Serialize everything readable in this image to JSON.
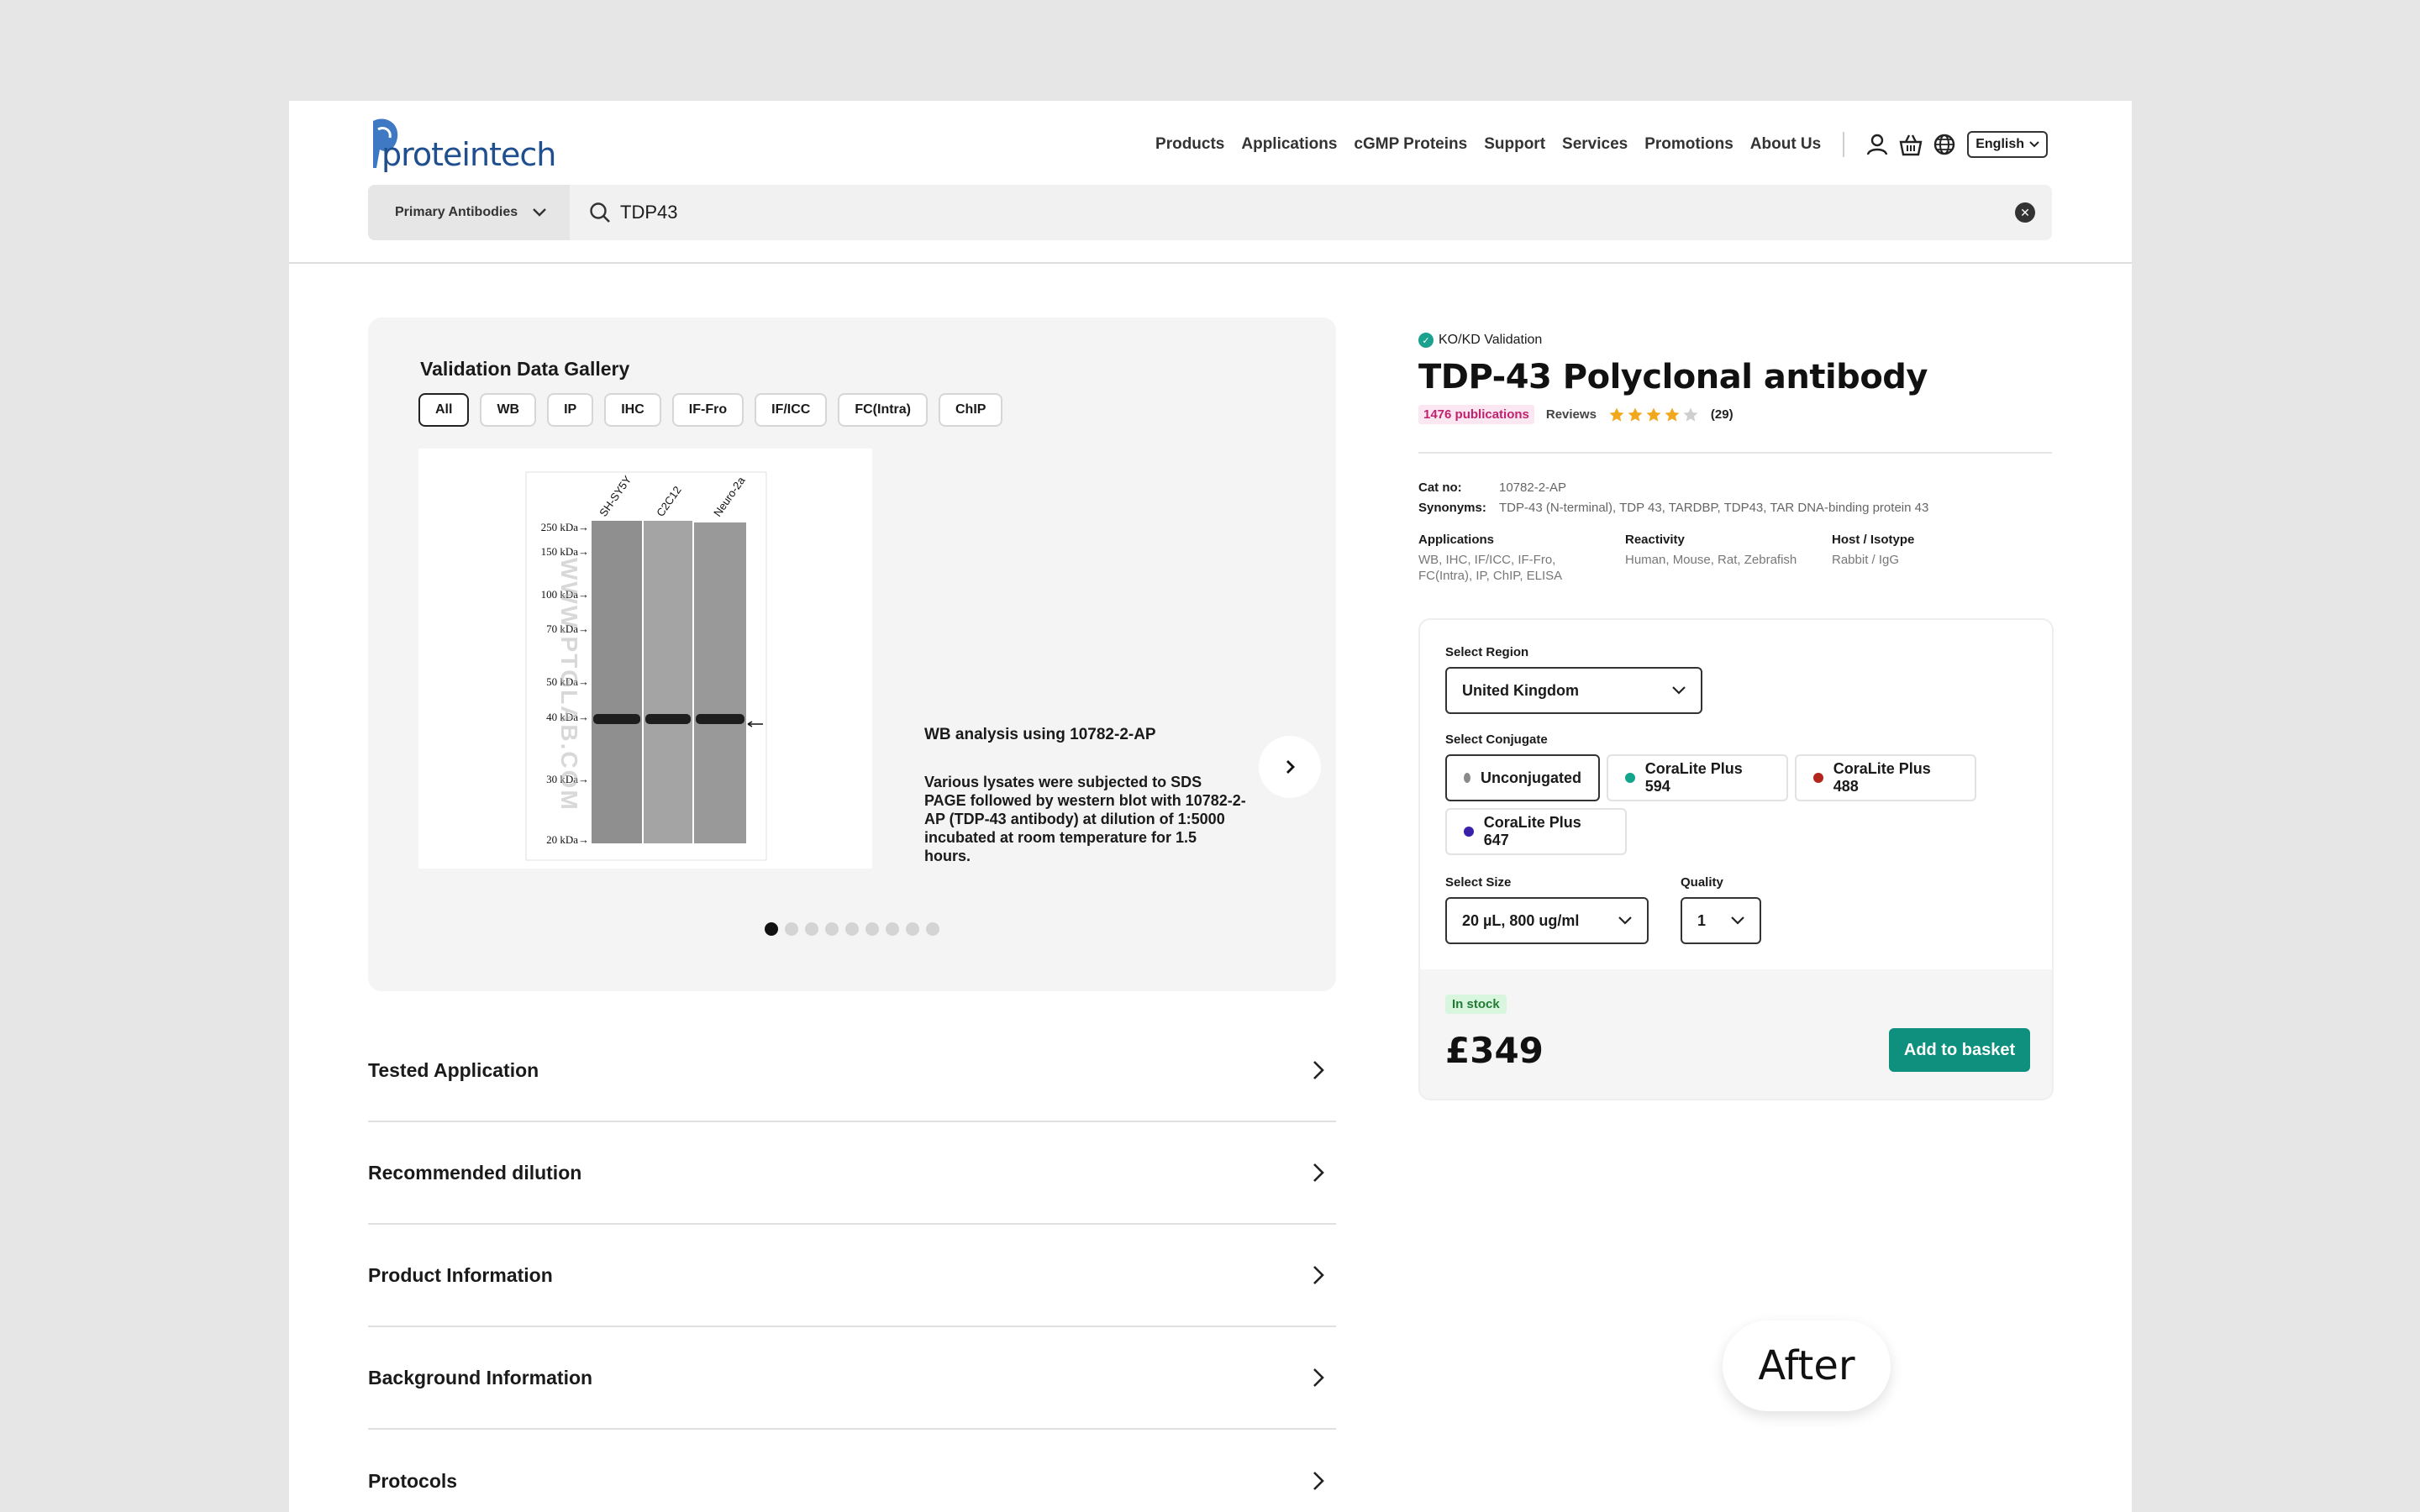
{
  "header": {
    "logo_text": "proteintech",
    "nav": [
      "Products",
      "Applications",
      "cGMP Proteins",
      "Support",
      "Services",
      "Promotions",
      "About Us"
    ],
    "language": "English",
    "search": {
      "category": "Primary Antibodies",
      "value": "TDP43"
    }
  },
  "gallery": {
    "title": "Validation Data Gallery",
    "filters": [
      "All",
      "WB",
      "IP",
      "IHC",
      "IF-Fro",
      "IF/ICC",
      "FC(Intra)",
      "ChIP"
    ],
    "active_filter": "All",
    "blot": {
      "lanes": [
        "SH-SY5Y",
        "C2C12",
        "Neuro-2a"
      ],
      "markers": [
        "250 kDa→",
        "150 kDa→",
        "100 kDa→",
        "70 kDa→",
        "50 kDa→",
        "40 kDa→",
        "30 kDa→",
        "20 kDa→"
      ],
      "watermark": "WWW.PTGLAB.COM"
    },
    "caption_title": "WB analysis using 10782-2-AP",
    "caption_text": "Various lysates were subjected to SDS PAGE followed by western blot with 10782-2-AP (TDP-43 antibody) at dilution of 1:5000 incubated at room temperature for 1.5 hours.",
    "dot_count": 9,
    "active_dot": 0
  },
  "accordion": [
    "Tested Application",
    "Recommended dilution",
    "Product Information",
    "Background Information",
    "Protocols"
  ],
  "product": {
    "validation_badge": "KO/KD Validation",
    "title": "TDP-43 Polyclonal antibody",
    "publications": "1476 publications",
    "reviews_label": "Reviews",
    "rating": 4,
    "rating_max": 5,
    "reviews_count": "(29)",
    "cat_label": "Cat no:",
    "cat_no": "10782-2-AP",
    "synonyms_label": "Synonyms:",
    "synonyms": "TDP-43 (N-terminal), TDP 43, TARDBP, TDP43, TAR DNA-binding protein 43",
    "applications_label": "Applications",
    "applications": "WB, IHC, IF/ICC, IF-Fro, FC(Intra), IP, ChIP, ELISA",
    "reactivity_label": "Reactivity",
    "reactivity": "Human, Mouse, Rat, Zebrafish",
    "host_label": "Host / Isotype",
    "host": "Rabbit / IgG"
  },
  "purchase": {
    "region_label": "Select Region",
    "region": "United Kingdom",
    "conjugate_label": "Select Conjugate",
    "conjugates": [
      {
        "name": "Unconjugated",
        "color": "#8a8a8a"
      },
      {
        "name": "CoraLite Plus 594",
        "color": "#14a58f"
      },
      {
        "name": "CoraLite Plus 488",
        "color": "#b3261e"
      },
      {
        "name": "CoraLite Plus 647",
        "color": "#3a1fa8"
      }
    ],
    "active_conjugate": "Unconjugated",
    "size_label": "Select Size",
    "size": "20 µL, 800 ug/ml",
    "quantity_label": "Quality",
    "quantity": "1",
    "stock": "In stock",
    "price": "£349",
    "add_button": "Add to basket"
  },
  "overlay_label": "After"
}
